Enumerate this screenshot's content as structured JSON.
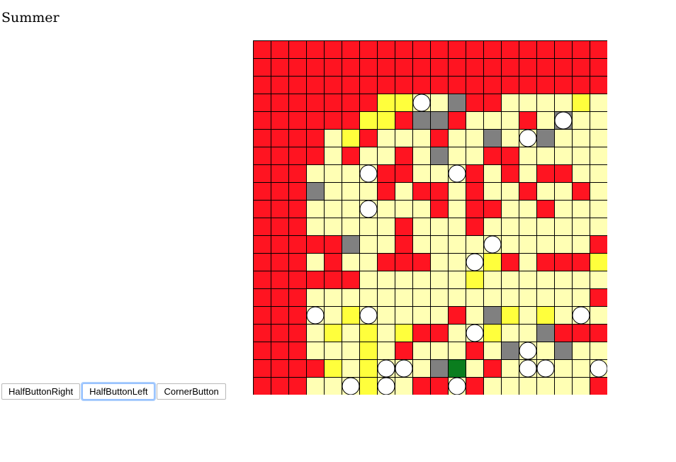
{
  "page": {
    "title": "Summer"
  },
  "buttons": {
    "half_right": "HalfButtonRight",
    "half_left": "HalfButtonLeft",
    "corner": "CornerButton"
  },
  "board": {
    "rows": 20,
    "cols": 20,
    "colors": {
      "R": "#ff1421",
      "P": "#ffffb4",
      "Y": "#ffff3c",
      "G": "#808080",
      "N": "#0a7d1e",
      "ball": "#ffffff",
      "grid_line": "#000000"
    },
    "grid": [
      "RRRRRRRRRRRRRRRRRRRR",
      "RRRRRRRRRRRRRRRRRRRR",
      "RRRRRRRRRRRRRRRRRRRR",
      "RRRRRRRYYPPGRRPPPPYP",
      "RRRRRRYYRGGRPPPRPGPP",
      "RRRRPYRPPPRPPGPPGPPP",
      "RRRRPRPPRPGPPRRPPPPP",
      "RRRPPPPRRPPPRPRPRRPP",
      "RRRGPPPRPRRPRPPRPPRP",
      "RRRPPPPPPPRPRRPPRPPP",
      "RRRPPPPPRPPPRPPPPPPP",
      "RRRRRGPPRPPPPPPPPPPR",
      "RRRPRPPRRRPPPYRPRRRY",
      "RRRRRRPPPPPPYPPPPPPP",
      "RRRPPPPPPPPPPPPPPPPR",
      "RRRPPYPPPPPRPGYPYPPP",
      "RRRPYPYPYRRPPYPPGRRR",
      "RRRPPPYPRPPPRPGPPGPP",
      "RRRRYPYPPPGNPRPPPPPP",
      "RRRPPPYPPRRPRPPPPPPR"
    ],
    "balls": [
      [
        3,
        9
      ],
      [
        4,
        17
      ],
      [
        5,
        15
      ],
      [
        7,
        6
      ],
      [
        7,
        11
      ],
      [
        9,
        6
      ],
      [
        11,
        13
      ],
      [
        12,
        12
      ],
      [
        15,
        3
      ],
      [
        15,
        6
      ],
      [
        15,
        18
      ],
      [
        16,
        12
      ],
      [
        17,
        15
      ],
      [
        18,
        7
      ],
      [
        18,
        8
      ],
      [
        18,
        15
      ],
      [
        18,
        16
      ],
      [
        18,
        19
      ],
      [
        19,
        5
      ],
      [
        19,
        7
      ],
      [
        19,
        11
      ]
    ]
  }
}
